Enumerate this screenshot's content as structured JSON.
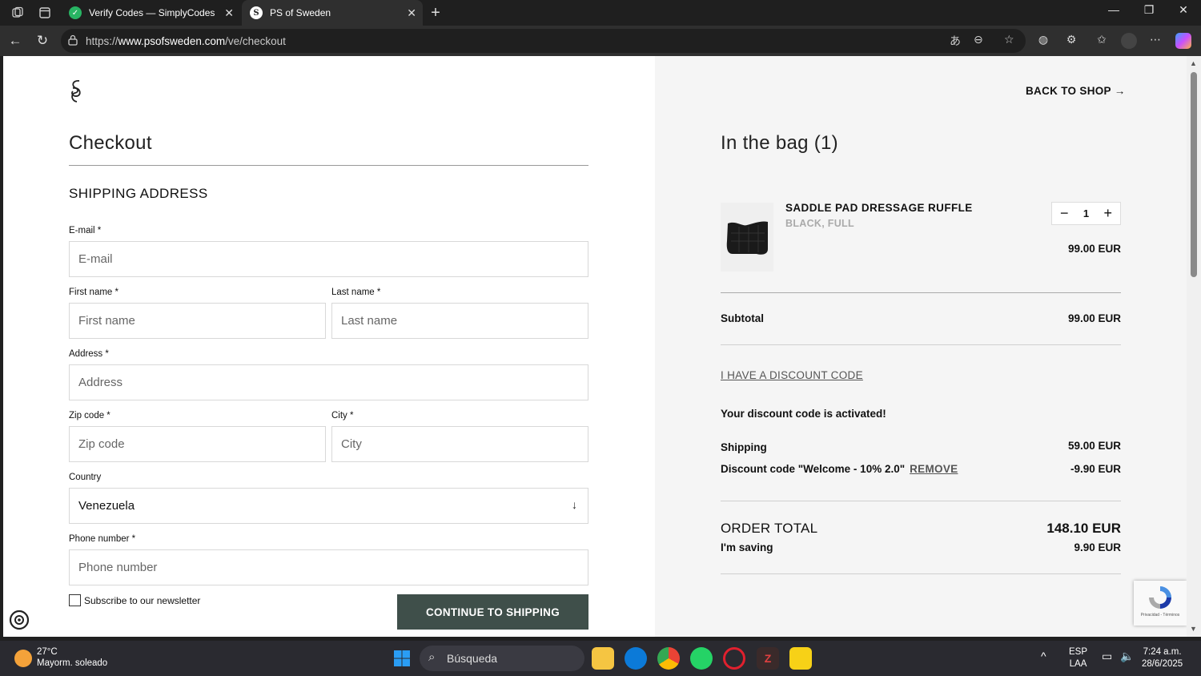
{
  "browser": {
    "tabs": [
      {
        "title": "Verify Codes — SimplyCodes"
      },
      {
        "title": "PS of Sweden"
      }
    ],
    "url_prefix": "https://",
    "url_host": "www.psofsweden.com",
    "url_path": "/ve/checkout"
  },
  "checkout": {
    "title": "Checkout",
    "section_title": "SHIPPING ADDRESS",
    "fields": {
      "email": {
        "label": "E-mail *",
        "placeholder": "E-mail"
      },
      "first_name": {
        "label": "First name *",
        "placeholder": "First name"
      },
      "last_name": {
        "label": "Last name *",
        "placeholder": "Last name"
      },
      "address": {
        "label": "Address *",
        "placeholder": "Address"
      },
      "zip": {
        "label": "Zip code *",
        "placeholder": "Zip code"
      },
      "city": {
        "label": "City *",
        "placeholder": "City"
      },
      "country": {
        "label": "Country",
        "value": "Venezuela"
      },
      "phone": {
        "label": "Phone number *",
        "placeholder": "Phone number"
      }
    },
    "newsletter_label": "Subscribe to our newsletter",
    "continue_label": "CONTINUE TO SHIPPING"
  },
  "bag": {
    "back_label": "BACK TO SHOP",
    "title": "In the bag (1)",
    "item": {
      "name": "SADDLE PAD DRESSAGE RUFFLE",
      "variant": "BLACK, FULL",
      "quantity": "1",
      "price": "99.00 EUR"
    },
    "subtotal_label": "Subtotal",
    "subtotal_value": "99.00 EUR",
    "discount_link": "I HAVE A DISCOUNT CODE",
    "discount_activated": "Your discount code is activated!",
    "shipping_label": "Shipping",
    "shipping_value": "59.00 EUR",
    "discount_line_label": "Discount code \"Welcome - 10% 2.0\"",
    "remove_label": "REMOVE",
    "discount_line_value": "-9.90 EUR",
    "order_total_label": "ORDER TOTAL",
    "order_total_value": "148.10 EUR",
    "saving_label": "I'm saving",
    "saving_value": "9.90 EUR"
  },
  "recaptcha_text": "Privacidad - Términos",
  "taskbar": {
    "temp": "27°C",
    "weather": "Mayorm. soleado",
    "search_placeholder": "Búsqueda",
    "lang_1": "ESP",
    "lang_2": "LAA",
    "time": "7:24 a.m.",
    "date": "28/6/2025"
  },
  "colors": {
    "continue_button": "#3f4f4a",
    "right_panel": "#f5f5f5"
  }
}
